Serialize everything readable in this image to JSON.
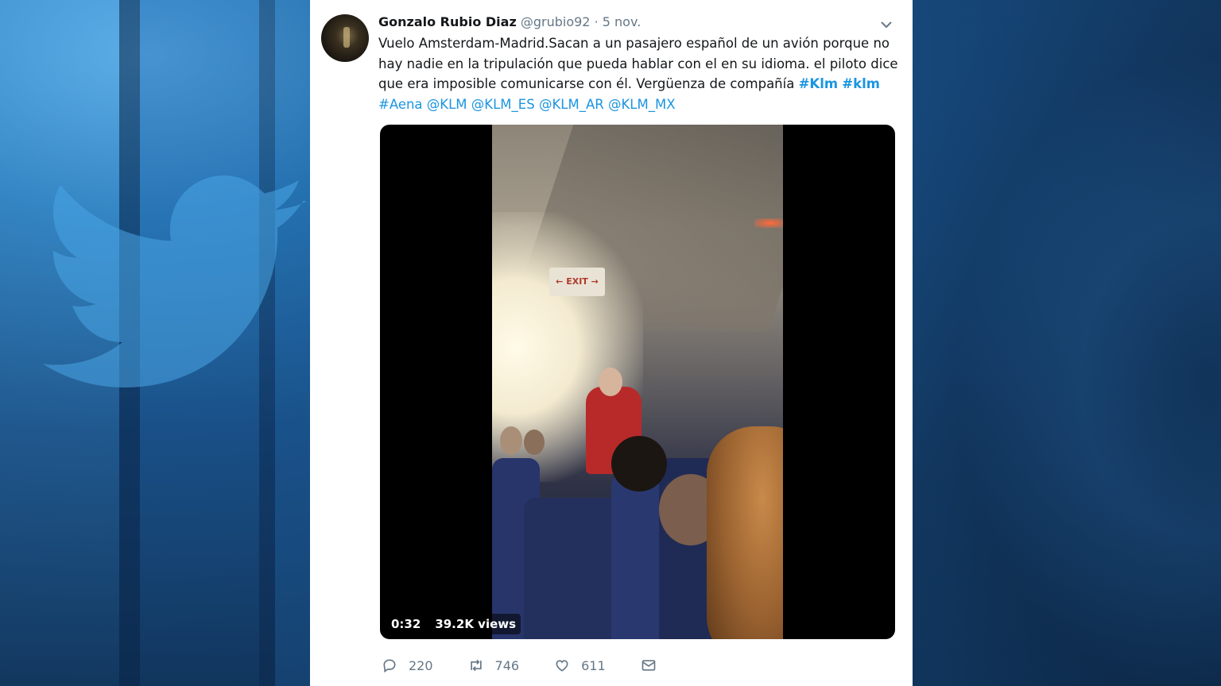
{
  "tweet": {
    "author_name": "Gonzalo Rubio Diaz",
    "handle": "@grubio92",
    "separator": "·",
    "date": "5 nov.",
    "lines": [
      "Vuelo Amsterdam-Madrid.Sacan a un pasajero español de un avión porque no",
      "hay nadie en la tripulación que pueda hablar con el en su idioma. el piloto dice",
      "que era imposible comunicarse con él. Vergüenza de compañía"
    ],
    "hashtag_1": "#Klm",
    "hashtag_2": "#klm",
    "hashtag_3": "#Aena",
    "mention_1": "@KLM",
    "mention_2": "@KLM_ES",
    "mention_3": "@KLM_AR",
    "mention_4": "@KLM_MX"
  },
  "video": {
    "duration": "0:32",
    "views": "39.2K views",
    "exit_sign": "← EXIT →"
  },
  "actions": {
    "replies": "220",
    "retweets": "746",
    "likes": "611"
  },
  "colors": {
    "link": "#1b95e0",
    "text": "#14171a",
    "muted": "#657786"
  },
  "icons": [
    "chevron-down-icon",
    "reply-icon",
    "retweet-icon",
    "like-icon",
    "message-icon",
    "twitter-bird-icon"
  ]
}
